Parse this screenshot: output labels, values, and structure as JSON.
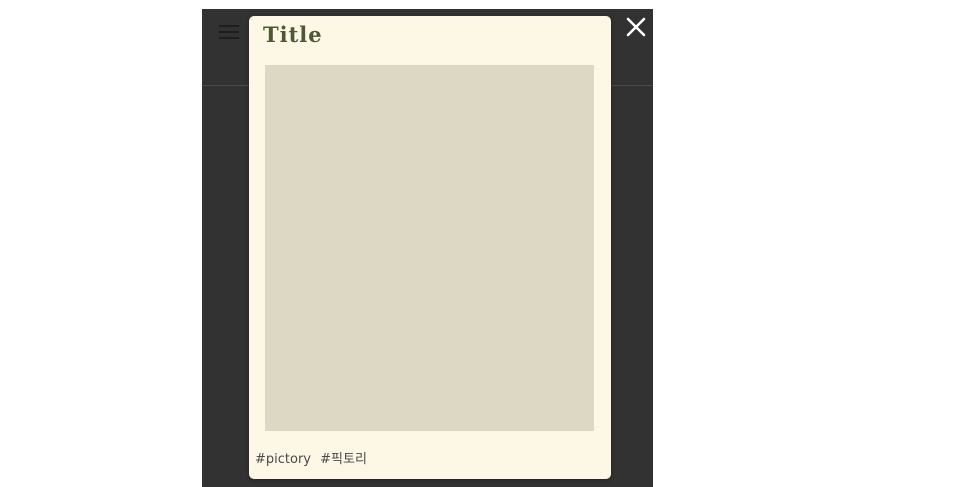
{
  "modal": {
    "title": "Title",
    "tags": [
      "#pictory",
      "#픽토리"
    ]
  },
  "icons": {
    "menu": "hamburger-menu-icon",
    "close": "close-icon"
  },
  "colors": {
    "backdrop": "#323232",
    "card_background": "#fdf7e6",
    "image_placeholder": "#dcd8c4",
    "title": "#4e5934",
    "tag_text": "#4a4a4a"
  }
}
